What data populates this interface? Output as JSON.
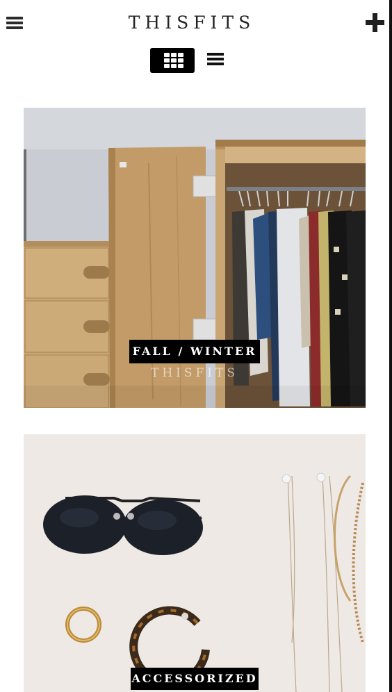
{
  "header": {
    "brand": "THISFITS",
    "menu_icon": "hamburger-menu-icon",
    "add_icon": "plus-icon"
  },
  "view_toggle": {
    "active": "grid",
    "grid_icon": "grid-view-icon",
    "list_icon": "list-view-icon"
  },
  "collections": [
    {
      "title": "FALL / WINTER",
      "subtitle": "THISFITS"
    },
    {
      "title": "ACCESSORIZED"
    }
  ],
  "colors": {
    "accent": "#000000",
    "background": "#ffffff"
  }
}
